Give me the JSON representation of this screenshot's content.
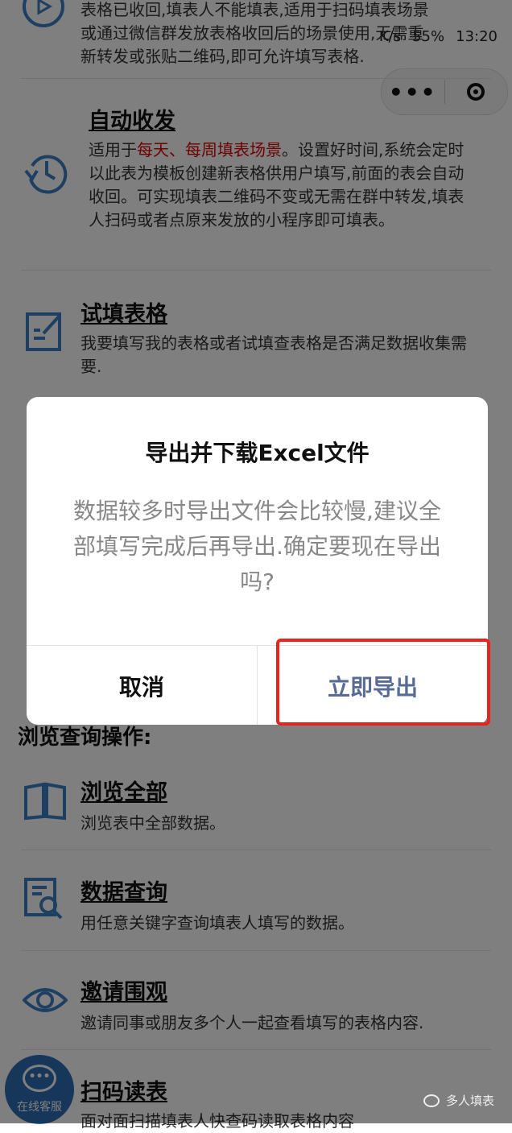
{
  "status_bar": {
    "speed": "K/s",
    "battery": "55%",
    "time": "13:20"
  },
  "capsule": {
    "more_label": "•••"
  },
  "top_partial": {
    "lines": [
      "表格已收回,填表人不能填表,适用于扫码填表场景",
      "或通过微信群发放表格收回后的场景使用,无需重",
      "新转发或张贴二维码,即可允许填写表格."
    ]
  },
  "items": [
    {
      "title": "自动收发",
      "desc_pre": "适用于",
      "desc_red": "每天、每周填表场景",
      "desc_post": "。设置好时间,系统会定时以此表为模板创建新表格供用户填写,前面的表会自动收回。可实现填表二维码不变或无需在群中转发,填表人扫码或者点原来发放的小程序即可填表。"
    },
    {
      "title": "试填表格",
      "desc": "我要填写我的表格或者试填查表格是否满足数据收集需要."
    }
  ],
  "section_browse": "浏览查询操作:",
  "browse_items": [
    {
      "title": "浏览全部",
      "desc": "浏览表中全部数据。"
    },
    {
      "title": "数据查询",
      "desc": "用任意关键字查询填表人填写的数据。"
    },
    {
      "title": "邀请围观",
      "desc": "邀请同事或朋友多个人一起查看填写的表格内容."
    },
    {
      "title": "扫码读表",
      "desc": "面对面扫描填表人快查码读取表格内容"
    }
  ],
  "dialog": {
    "title": "导出并下载Excel文件",
    "message": "数据较多时导出文件会比较慢,建议全部填写完成后再导出.确定要现在导出吗?",
    "cancel_label": "取消",
    "confirm_label": "立即导出"
  },
  "service_button": {
    "bubble": "•••",
    "label": "在线客服"
  },
  "footer": {
    "brand": "多人填表"
  },
  "colors": {
    "accent_blue": "#3b7fc4",
    "highlight_red": "#e8231e",
    "confirm_text": "#576b95",
    "emphasis_red": "#dd0000"
  }
}
